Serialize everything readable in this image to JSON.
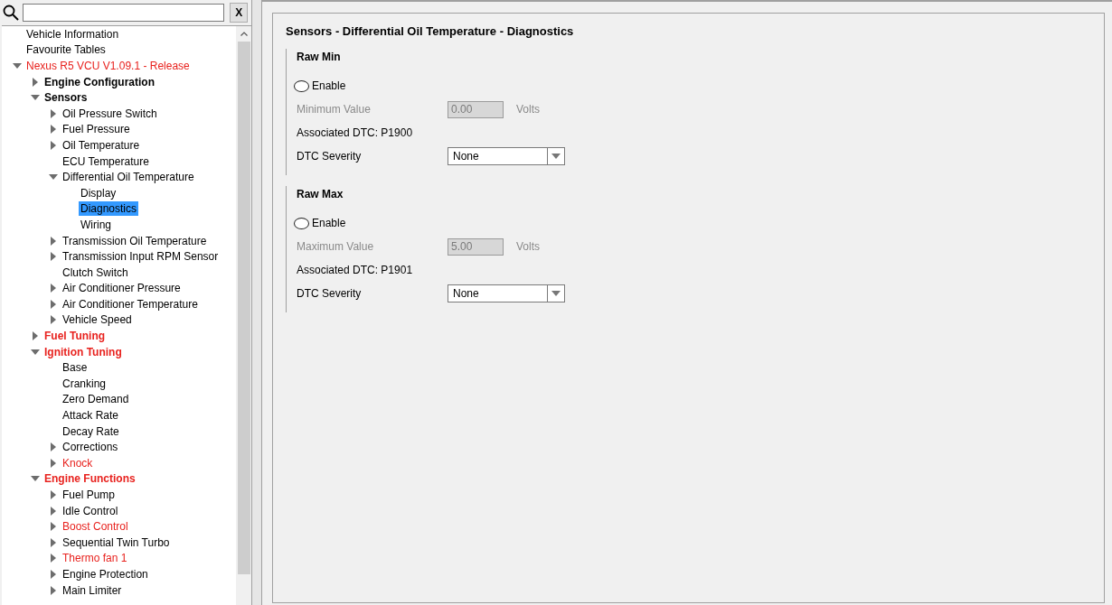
{
  "search": {
    "clear_button": "X"
  },
  "tree": [
    {
      "label": "Vehicle Information",
      "selected": false,
      "error": false
    },
    {
      "label": "Favourite Tables",
      "selected": false,
      "error": false
    },
    {
      "label": "Nexus R5 VCU V1.09.1 - Release",
      "selected": false,
      "error": true,
      "expanded": true,
      "children": [
        {
          "label": "Engine Configuration",
          "selected": false,
          "error": false,
          "expanded": false
        },
        {
          "label": "Sensors",
          "selected": false,
          "error": false,
          "expanded": true,
          "children": [
            {
              "label": "Oil Pressure Switch",
              "selected": false,
              "error": false,
              "expanded": false
            },
            {
              "label": "Fuel Pressure",
              "selected": false,
              "error": false,
              "expanded": false
            },
            {
              "label": "Oil Temperature",
              "selected": false,
              "error": false,
              "expanded": false
            },
            {
              "label": "ECU Temperature",
              "selected": false,
              "error": false
            },
            {
              "label": "Differential Oil Temperature",
              "selected": false,
              "error": false,
              "expanded": true,
              "children": [
                {
                  "label": "Display",
                  "selected": false,
                  "error": false
                },
                {
                  "label": "Diagnostics",
                  "selected": true,
                  "error": false
                },
                {
                  "label": "Wiring",
                  "selected": false,
                  "error": false
                }
              ]
            },
            {
              "label": "Transmission Oil Temperature",
              "selected": false,
              "error": false,
              "expanded": false
            },
            {
              "label": "Transmission Input RPM Sensor",
              "selected": false,
              "error": false,
              "expanded": false
            },
            {
              "label": "Clutch Switch",
              "selected": false,
              "error": false
            },
            {
              "label": "Air Conditioner Pressure",
              "selected": false,
              "error": false,
              "expanded": false
            },
            {
              "label": "Air Conditioner Temperature",
              "selected": false,
              "error": false,
              "expanded": false
            },
            {
              "label": "Vehicle Speed",
              "selected": false,
              "error": false,
              "expanded": false
            }
          ]
        },
        {
          "label": "Fuel Tuning",
          "selected": false,
          "error": true,
          "expanded": false
        },
        {
          "label": "Ignition Tuning",
          "selected": false,
          "error": true,
          "expanded": true,
          "children": [
            {
              "label": "Base",
              "selected": false,
              "error": false
            },
            {
              "label": "Cranking",
              "selected": false,
              "error": false
            },
            {
              "label": "Zero Demand",
              "selected": false,
              "error": false
            },
            {
              "label": "Attack Rate",
              "selected": false,
              "error": false
            },
            {
              "label": "Decay Rate",
              "selected": false,
              "error": false
            },
            {
              "label": "Corrections",
              "selected": false,
              "error": false,
              "expanded": false
            },
            {
              "label": "Knock",
              "selected": false,
              "error": true,
              "expanded": false
            }
          ]
        },
        {
          "label": "Engine Functions",
          "selected": false,
          "error": true,
          "expanded": true,
          "children": [
            {
              "label": "Fuel Pump",
              "selected": false,
              "error": false,
              "expanded": false
            },
            {
              "label": "Idle Control",
              "selected": false,
              "error": false,
              "expanded": false
            },
            {
              "label": "Boost Control",
              "selected": false,
              "error": true,
              "expanded": false
            },
            {
              "label": "Sequential Twin Turbo",
              "selected": false,
              "error": false,
              "expanded": false
            },
            {
              "label": "Thermo fan 1",
              "selected": false,
              "error": true,
              "expanded": false
            },
            {
              "label": "Engine Protection",
              "selected": false,
              "error": false,
              "expanded": false
            },
            {
              "label": "Main Limiter",
              "selected": false,
              "error": false,
              "expanded": false
            }
          ]
        }
      ]
    }
  ],
  "page_title": "Sensors - Differential Oil Temperature - Diagnostics",
  "sections": [
    {
      "title": "Raw Min",
      "enable": {
        "label": "Enable",
        "checked": false
      },
      "value": {
        "label": "Minimum Value",
        "value": "0.00",
        "unit": "Volts",
        "disabled": true
      },
      "dtc": "Associated DTC: P1900",
      "severity": {
        "label": "DTC Severity",
        "value": "None"
      }
    },
    {
      "title": "Raw Max",
      "enable": {
        "label": "Enable",
        "checked": false
      },
      "value": {
        "label": "Maximum Value",
        "value": "5.00",
        "unit": "Volts",
        "disabled": true
      },
      "dtc": "Associated DTC: P1901",
      "severity": {
        "label": "DTC Severity",
        "value": "None"
      }
    }
  ]
}
